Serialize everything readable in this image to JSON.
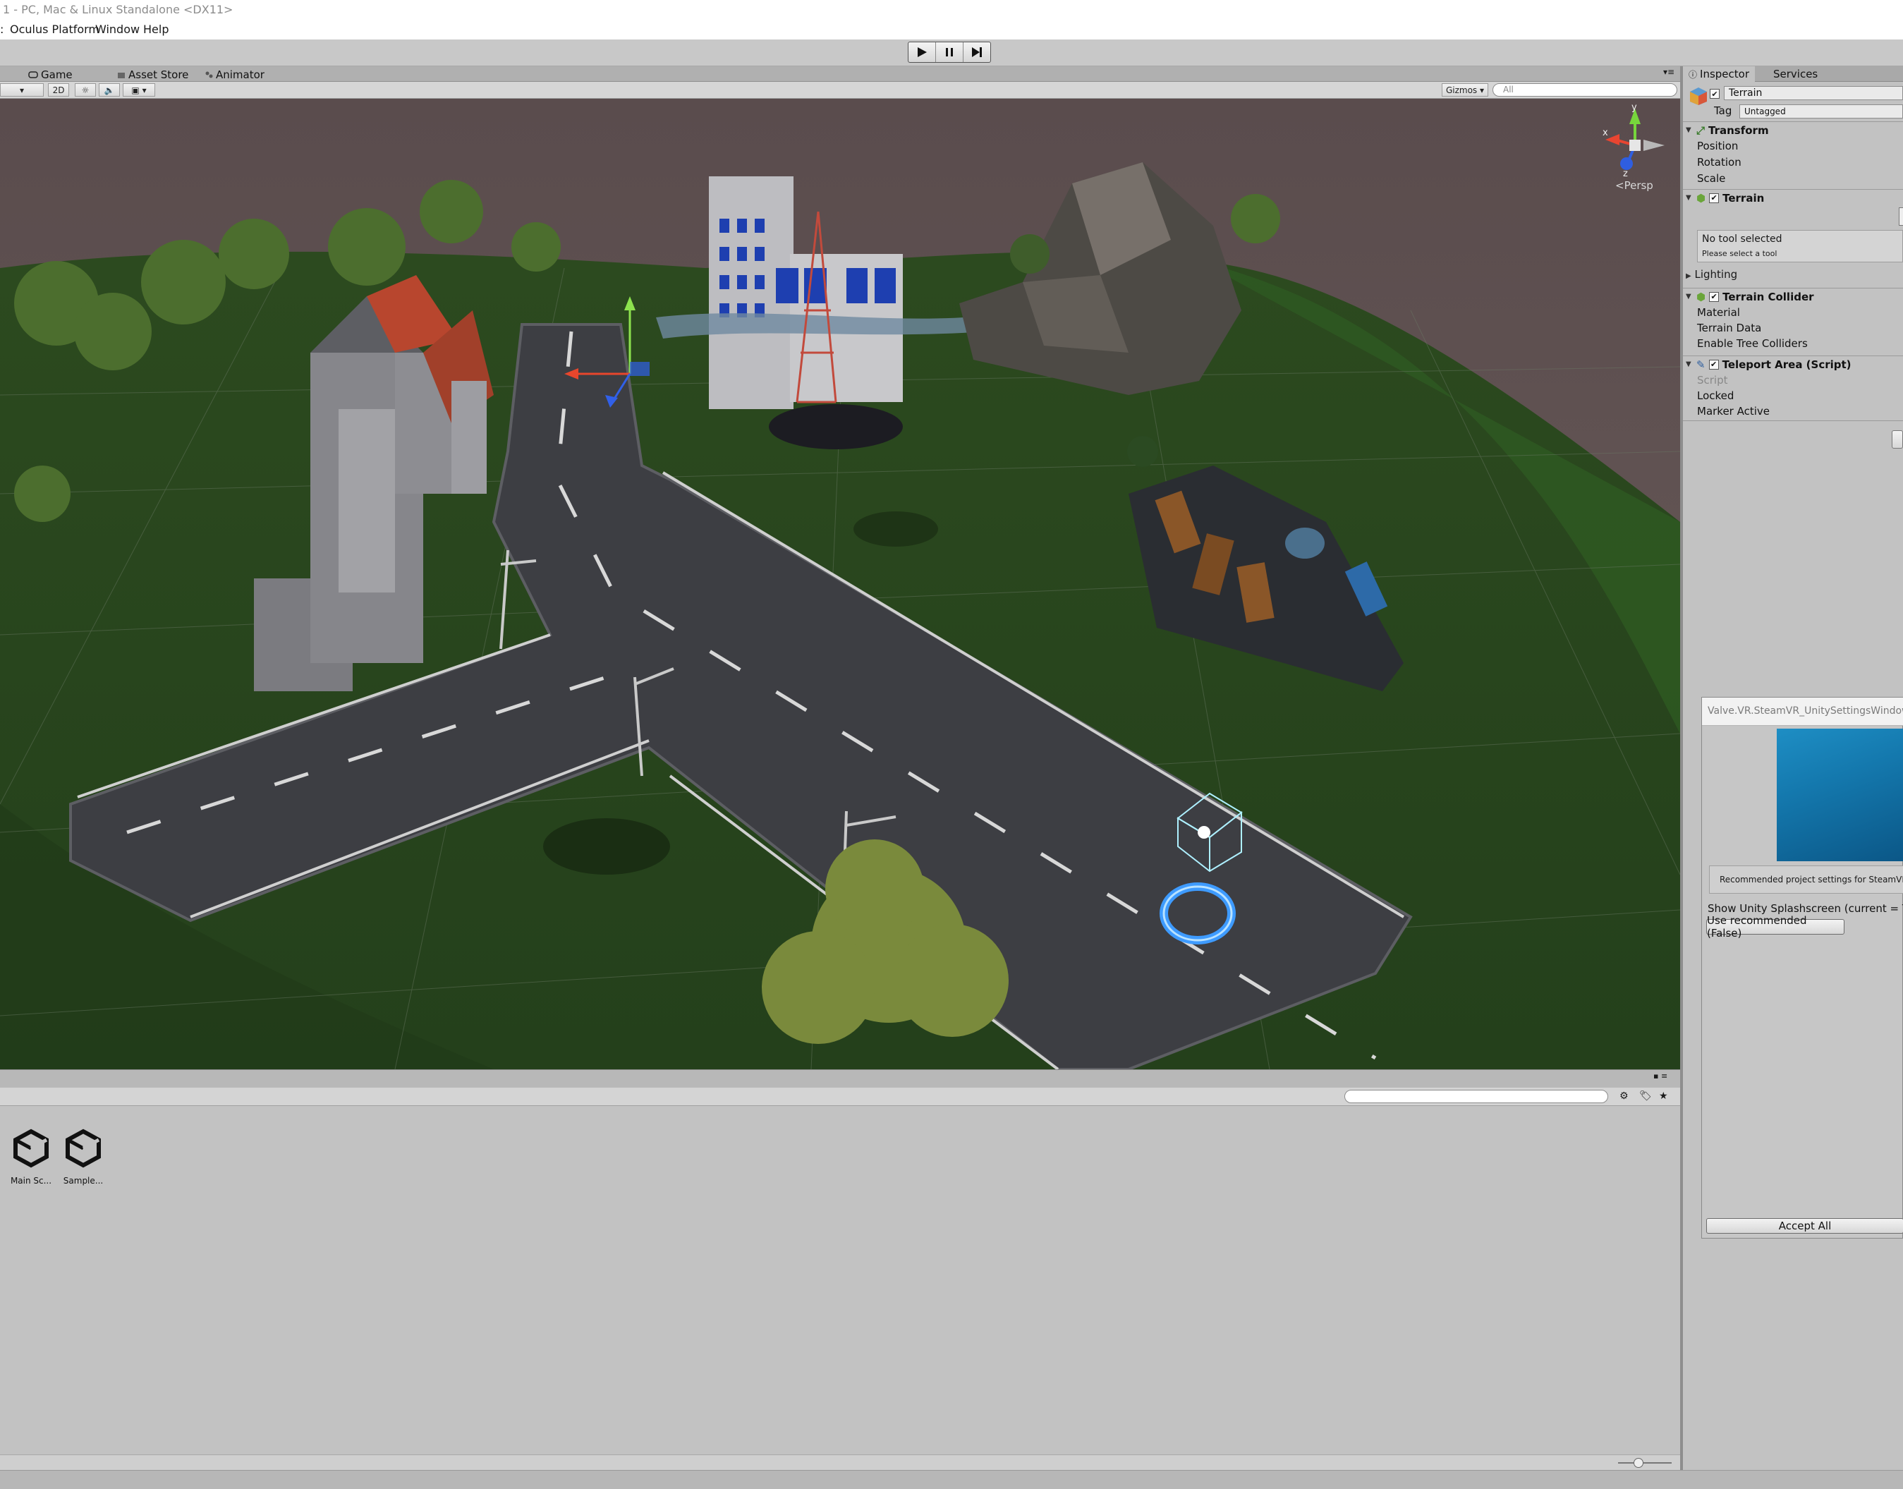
{
  "window": {
    "title": "1 - PC, Mac & Linux Standalone <DX11>"
  },
  "menu": [
    "Oculus Platform",
    "Window",
    "Help"
  ],
  "toolbar": {
    "play_icon": "play-icon",
    "pause_icon": "pause-icon",
    "step_icon": "step-icon"
  },
  "tabs": {
    "game": "Game",
    "asset_store": "Asset Store",
    "animator": "Animator"
  },
  "scene_toolbar": {
    "mode_2d": "2D",
    "gizmos": "Gizmos",
    "search_placeholder": "All"
  },
  "scene_gizmo": {
    "y": "y",
    "x": "x",
    "z": "z",
    "view": "Persp"
  },
  "project": {
    "assets": [
      {
        "label": "Main Sc..."
      },
      {
        "label": "Sample..."
      }
    ]
  },
  "inspector": {
    "tabs": [
      "Inspector",
      "Services"
    ],
    "object_name": "Terrain",
    "tag_label": "Tag",
    "tag_value": "Untagged",
    "transform": {
      "title": "Transform",
      "props": [
        "Position",
        "Rotation",
        "Scale"
      ]
    },
    "terrain": {
      "title": "Terrain",
      "help_title": "No tool selected",
      "help_sub": "Please select a tool",
      "lighting": "Lighting"
    },
    "terrain_collider": {
      "title": "Terrain Collider",
      "props": [
        "Material",
        "Terrain Data",
        "Enable Tree Colliders"
      ]
    },
    "teleport_area": {
      "title": "Teleport Area (Script)",
      "props": [
        "Script",
        "Locked",
        "Marker Active"
      ]
    }
  },
  "steamvr_window": {
    "title": "Valve.VR.SteamVR_UnitySettingsWindow",
    "warning": "Recommended project settings for SteamVR:",
    "setting": "Show Unity Splashscreen (current = True)",
    "use_recommended": "Use recommended (False)",
    "accept_all": "Accept All"
  },
  "colors": {
    "terrain_green": "#2d4a22",
    "road": "#3e3f44",
    "sky": "#5b4e4f",
    "steam_blue": "#1478ad",
    "teleport_ring": "#2f8cff"
  }
}
